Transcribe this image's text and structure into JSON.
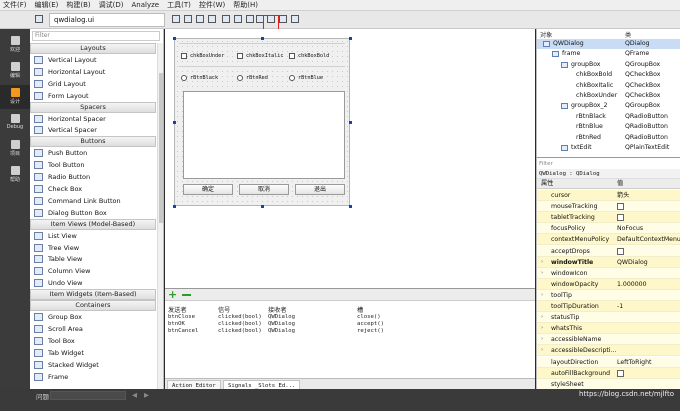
{
  "menu": [
    "文件(F)",
    "编辑(E)",
    "构建(B)",
    "调试(D)",
    "Analyze",
    "工具(T)",
    "控件(W)",
    "帮助(H)"
  ],
  "file_tab": "qwdialog.ui",
  "modes": [
    {
      "label": "欢迎",
      "icon": "grid-icon"
    },
    {
      "label": "编辑",
      "icon": "document-icon"
    },
    {
      "label": "设计",
      "icon": "pencil-icon"
    },
    {
      "label": "Debug",
      "icon": "bug-icon"
    },
    {
      "label": "项目",
      "icon": "wrench-icon"
    },
    {
      "label": "帮助",
      "icon": "question-icon"
    }
  ],
  "widget_box": {
    "filter_placeholder": "Filter",
    "sections": [
      {
        "title": "Layouts",
        "items": [
          "Vertical Layout",
          "Horizontal Layout",
          "Grid Layout",
          "Form Layout"
        ]
      },
      {
        "title": "Spacers",
        "items": [
          "Horizontal Spacer",
          "Vertical Spacer"
        ]
      },
      {
        "title": "Buttons",
        "items": [
          "Push Button",
          "Tool Button",
          "Radio Button",
          "Check Box",
          "Command Link Button",
          "Dialog Button Box"
        ]
      },
      {
        "title": "Item Views (Model-Based)",
        "items": [
          "List View",
          "Tree View",
          "Table View",
          "Column View",
          "Undo View"
        ]
      },
      {
        "title": "Item Widgets (Item-Based)",
        "items": []
      },
      {
        "title": "Containers",
        "items": [
          "Group Box",
          "Scroll Area",
          "Tool Box",
          "Tab Widget",
          "Stacked Widget",
          "Frame"
        ]
      }
    ]
  },
  "form": {
    "checkboxes": [
      "chkBoxUnder",
      "chkBoxItalic",
      "chkBoxBold"
    ],
    "radios": [
      "rBtnBlack",
      "rBtnRed",
      "rBtnBlue"
    ],
    "buttons": [
      "确定",
      "取消",
      "退出"
    ]
  },
  "signals": {
    "headers": [
      "发送者",
      "信号",
      "接收者",
      "槽"
    ],
    "rows": [
      [
        "btnClose",
        "clicked(bool)",
        "QWDialog",
        "close()"
      ],
      [
        "btnOK",
        "clicked(bool)",
        "QWDialog",
        "accept()"
      ],
      [
        "btnCancel",
        "clicked(bool)",
        "QWDialog",
        "reject()"
      ]
    ],
    "tabs": [
      "Action Editor",
      "Signals _Slots Ed..."
    ]
  },
  "object_inspector": {
    "headers": [
      "对象",
      "类"
    ],
    "rows": [
      {
        "name": "QWDialog",
        "class": "QDialog",
        "level": 0
      },
      {
        "name": "frame",
        "class": "QFrame",
        "level": 1
      },
      {
        "name": "groupBox",
        "class": "QGroupBox",
        "level": 2
      },
      {
        "name": "chkBoxBold",
        "class": "QCheckBox",
        "level": 3
      },
      {
        "name": "chkBoxItalic",
        "class": "QCheckBox",
        "level": 3
      },
      {
        "name": "chkBoxUnder",
        "class": "QCheckBox",
        "level": 3
      },
      {
        "name": "groupBox_2",
        "class": "QGroupBox",
        "level": 2
      },
      {
        "name": "rBtnBlack",
        "class": "QRadioButton",
        "level": 3
      },
      {
        "name": "rBtnBlue",
        "class": "QRadioButton",
        "level": 3
      },
      {
        "name": "rBtnRed",
        "class": "QRadioButton",
        "level": 3
      },
      {
        "name": "txtEdit",
        "class": "QPlainTextEdit",
        "level": 2
      }
    ]
  },
  "property_editor": {
    "filter_placeholder": "Filter",
    "class_line": "QWDialog : QDialog",
    "headers": [
      "属性",
      "值"
    ],
    "rows": [
      {
        "name": "cursor",
        "value": "箭头",
        "type": "text"
      },
      {
        "name": "mouseTracking",
        "value": "",
        "type": "check"
      },
      {
        "name": "tabletTracking",
        "value": "",
        "type": "check"
      },
      {
        "name": "focusPolicy",
        "value": "NoFocus",
        "type": "text"
      },
      {
        "name": "contextMenuPolicy",
        "value": "DefaultContextMenu",
        "type": "text"
      },
      {
        "name": "acceptDrops",
        "value": "",
        "type": "check"
      },
      {
        "name": "windowTitle",
        "value": "QWDialog",
        "type": "text",
        "expand": true,
        "bold": true
      },
      {
        "name": "windowIcon",
        "value": "",
        "type": "text",
        "expand": true
      },
      {
        "name": "windowOpacity",
        "value": "1.000000",
        "type": "text"
      },
      {
        "name": "toolTip",
        "value": "",
        "type": "text",
        "expand": true
      },
      {
        "name": "toolTipDuration",
        "value": "-1",
        "type": "text"
      },
      {
        "name": "statusTip",
        "value": "",
        "type": "text",
        "expand": true
      },
      {
        "name": "whatsThis",
        "value": "",
        "type": "text",
        "expand": true
      },
      {
        "name": "accessibleName",
        "value": "",
        "type": "text",
        "expand": true
      },
      {
        "name": "accessibleDescripti...",
        "value": "",
        "type": "text",
        "expand": true
      },
      {
        "name": "layoutDirection",
        "value": "LeftToRight",
        "type": "text"
      },
      {
        "name": "autoFillBackground",
        "value": "",
        "type": "check"
      },
      {
        "name": "styleSheet",
        "value": "",
        "type": "text"
      }
    ]
  },
  "statusbar": {
    "issues": "问题",
    "search_placeholder": "",
    "watermark": "https://blog.csdn.net/mjlfto"
  },
  "colors": {
    "highlight_red": "#e0201a",
    "active_mode": "#f39a1e",
    "property_yellow": "#fdf7c9"
  }
}
